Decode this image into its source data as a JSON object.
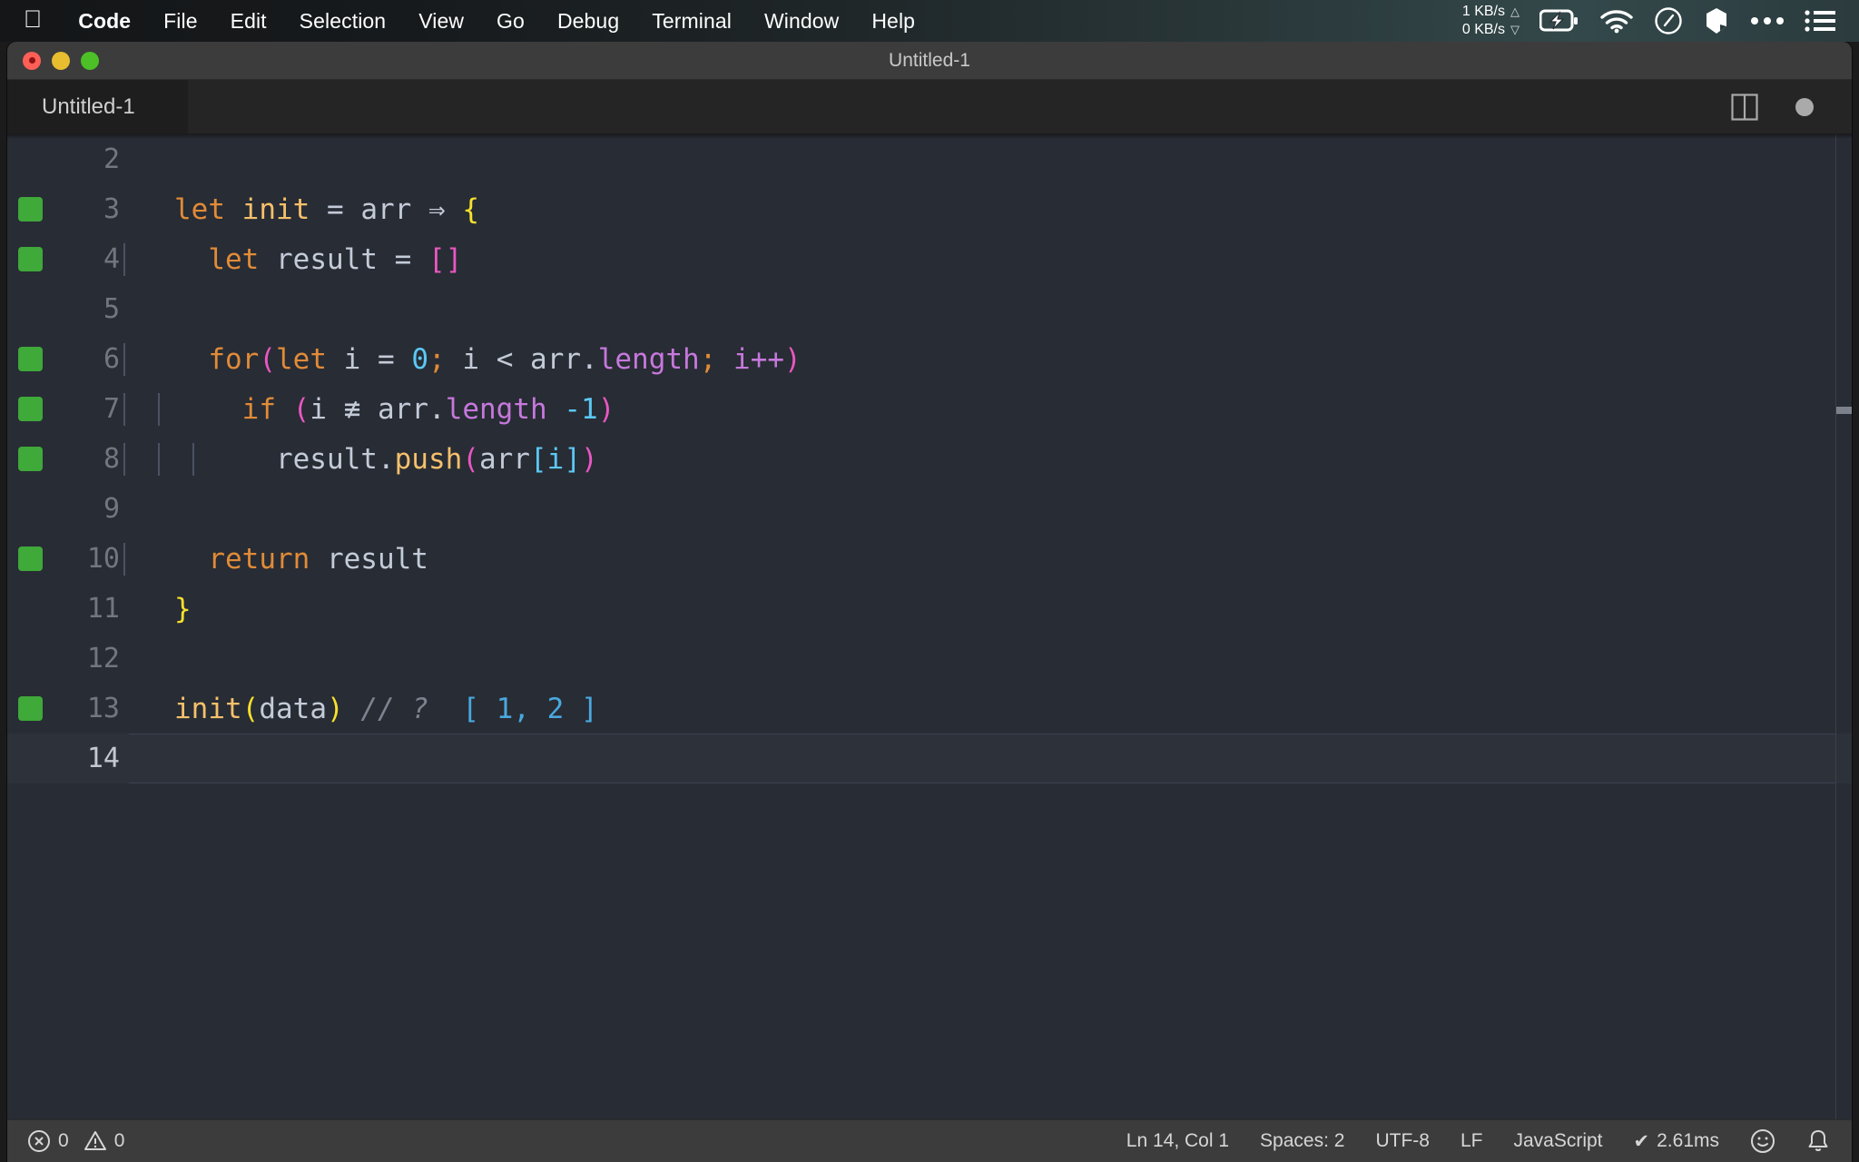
{
  "menubar": {
    "apple_icon": "apple-logo-icon",
    "items": [
      {
        "label": "Code",
        "bold": true
      },
      {
        "label": "File",
        "bold": false
      },
      {
        "label": "Edit",
        "bold": false
      },
      {
        "label": "Selection",
        "bold": false
      },
      {
        "label": "View",
        "bold": false
      },
      {
        "label": "Go",
        "bold": false
      },
      {
        "label": "Debug",
        "bold": false
      },
      {
        "label": "Terminal",
        "bold": false
      },
      {
        "label": "Window",
        "bold": false
      },
      {
        "label": "Help",
        "bold": false
      }
    ],
    "status": {
      "net_up": "1 KB/s",
      "net_down": "0 KB/s",
      "up_arrow": "▲",
      "down_arrow": "▽",
      "icons": [
        "battery-charging-icon",
        "wifi-icon",
        "clock-icon",
        "dropbox-icon",
        "ellipsis-icon",
        "control-center-list-icon"
      ]
    }
  },
  "window": {
    "title": "Untitled-1",
    "traffic_lights": [
      "close-button",
      "minimize-button",
      "maximize-button"
    ]
  },
  "tabbar": {
    "active_tab": "Untitled-1",
    "actions": [
      "split-editor-icon",
      "unsaved-dot-icon"
    ]
  },
  "editor": {
    "language_mode": "JavaScript",
    "lines": [
      {
        "num": "2",
        "covered": false,
        "current": false
      },
      {
        "num": "3",
        "covered": true,
        "current": false
      },
      {
        "num": "4",
        "covered": true,
        "current": false
      },
      {
        "num": "5",
        "covered": false,
        "current": false
      },
      {
        "num": "6",
        "covered": true,
        "current": false
      },
      {
        "num": "7",
        "covered": true,
        "current": false
      },
      {
        "num": "8",
        "covered": true,
        "current": false
      },
      {
        "num": "9",
        "covered": false,
        "current": false
      },
      {
        "num": "10",
        "covered": true,
        "current": false
      },
      {
        "num": "11",
        "covered": false,
        "current": false
      },
      {
        "num": "12",
        "covered": false,
        "current": false
      },
      {
        "num": "13",
        "covered": true,
        "current": false
      },
      {
        "num": "14",
        "covered": false,
        "current": true
      }
    ],
    "code": {
      "l2": "",
      "l3_kw": "let",
      "l3_name": "init",
      "l3_eq": "=",
      "l3_arg": "arr",
      "l3_arrow": "⇒",
      "l3_brace": "{",
      "l4_kw": "let",
      "l4_name": "result",
      "l4_eq": "=",
      "l4_brackets": "[]",
      "l6_kw": "for",
      "l6_open": "(",
      "l6_kw2": "let",
      "l6_i": "i",
      "l6_eq": "=",
      "l6_zero": "0",
      "l6_semi": ";",
      "l6_cond": "i < arr",
      "l6_dot": ".",
      "l6_length": "length",
      "l6_semi2": ";",
      "l6_inc": "i++",
      "l6_close": ")",
      "l7_kw": "if",
      "l7_open": "(",
      "l7_i": "i",
      "l7_neq": "≢",
      "l7_arr": "arr",
      "l7_dot": ".",
      "l7_length": "length",
      "l7_minus": "-",
      "l7_one": "1",
      "l7_close": ")",
      "l8_obj": "result",
      "l8_dot": ".",
      "l8_method": "push",
      "l8_open": "(",
      "l8_arr": "arr",
      "l8_brack_open": "[",
      "l8_i": "i",
      "l8_brack_close": "]",
      "l8_close": ")",
      "l10_kw": "return",
      "l10_val": "result",
      "l11_brace": "}",
      "l13_fn": "init",
      "l13_open": "(",
      "l13_arg": "data",
      "l13_close": ")",
      "l13_comment": "// ?",
      "l13_hint": "[ 1, 2 ]"
    }
  },
  "statusbar": {
    "errors_icon": "error-circle-icon",
    "errors": "0",
    "warnings_icon": "warning-triangle-icon",
    "warnings": "0",
    "cursor_position": "Ln 14, Col 1",
    "indentation": "Spaces: 2",
    "encoding": "UTF-8",
    "eol": "LF",
    "language": "JavaScript",
    "quokka_check": "✔",
    "quokka_time": "2.61ms",
    "feedback_icon": "smiley-icon",
    "notifications_icon": "bell-icon"
  }
}
